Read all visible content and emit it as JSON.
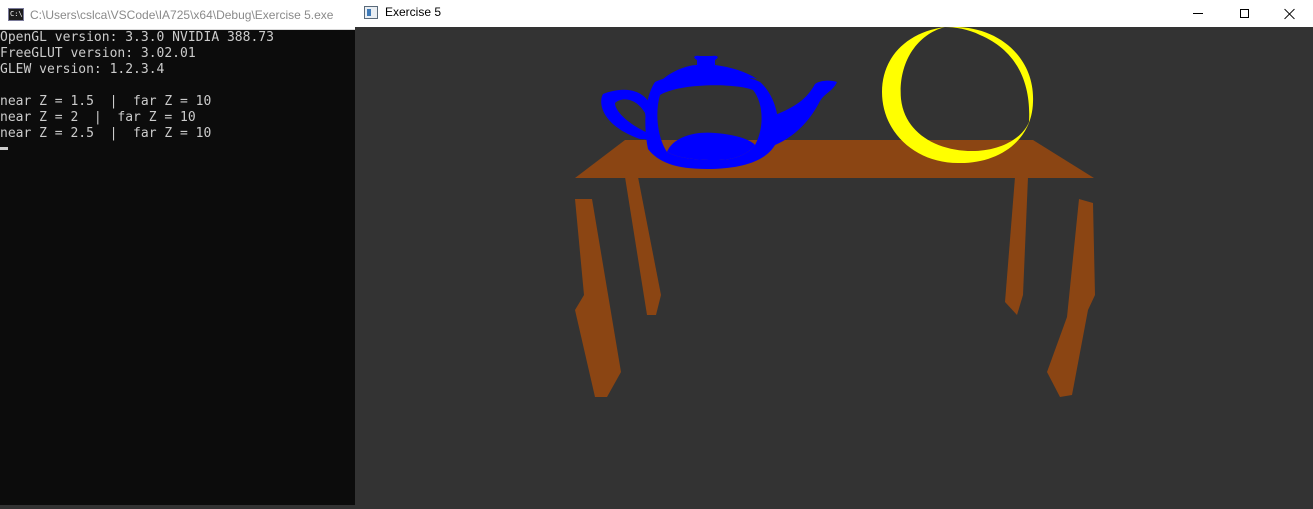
{
  "console_window": {
    "title": "C:\\Users\\cslca\\VSCode\\IA725\\x64\\Debug\\Exercise 5.exe",
    "lines": [
      "OpenGL version: 3.3.0 NVIDIA 388.73",
      "FreeGLUT version: 3.02.01",
      "GLEW version: 1.2.3.4",
      "",
      "near Z = 1.5  |  far Z = 10",
      "near Z = 2  |  far Z = 10",
      "near Z = 2.5  |  far Z = 10"
    ]
  },
  "gl_window": {
    "title": "Exercise 5",
    "buttons": [
      "minimize",
      "maximize",
      "close"
    ],
    "scene": {
      "background": "#333333",
      "objects": [
        "table",
        "teapot",
        "sphere"
      ],
      "colors": {
        "table": "#8b4513",
        "teapot": "#0000ff",
        "sphere": "#ffff00"
      }
    }
  }
}
